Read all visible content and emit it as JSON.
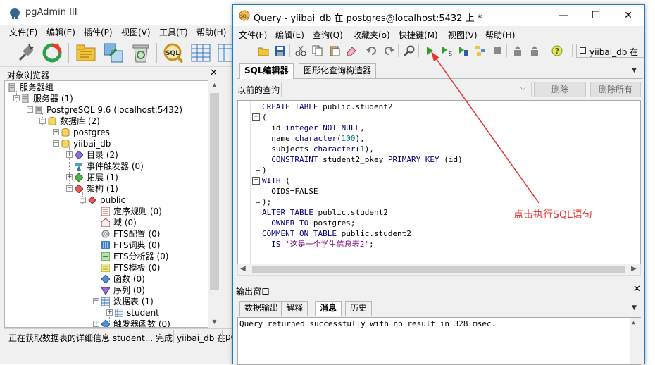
{
  "main": {
    "title": "pgAdmin III",
    "menu": [
      "文件(F)",
      "编辑(E)",
      "插件(P)",
      "视图(V)",
      "工具(T)",
      "帮助(H)"
    ],
    "browser_title": "对象浏览器",
    "close_glyph": "✕",
    "tree": [
      {
        "label": "服务器组",
        "icon": "server-group-icon"
      },
      {
        "label": "服务器 (1)",
        "icon": "servers-icon"
      },
      {
        "label": "PostgreSQL 9.6 (localhost:5432)",
        "icon": "postgres-server-icon"
      },
      {
        "label": "数据库 (2)",
        "icon": "databases-icon"
      },
      {
        "label": "postgres",
        "icon": "database-icon"
      },
      {
        "label": "yiibai_db",
        "icon": "database-icon"
      },
      {
        "label": "目录 (2)",
        "icon": "catalog-icon"
      },
      {
        "label": "事件触发器 (0)",
        "icon": "event-trigger-icon"
      },
      {
        "label": "拓展 (1)",
        "icon": "extension-icon"
      },
      {
        "label": "架构 (1)",
        "icon": "schemas-icon"
      },
      {
        "label": "public",
        "icon": "schema-icon"
      },
      {
        "label": "定序规则 (0)",
        "icon": "collation-icon"
      },
      {
        "label": "域 (0)",
        "icon": "domain-icon"
      },
      {
        "label": "FTS配置 (0)",
        "icon": "fts-config-icon"
      },
      {
        "label": "FTS词典 (0)",
        "icon": "fts-dictionary-icon"
      },
      {
        "label": "FTS分析器 (0)",
        "icon": "fts-parser-icon"
      },
      {
        "label": "FTS模板 (0)",
        "icon": "fts-template-icon"
      },
      {
        "label": "函数 (0)",
        "icon": "function-icon"
      },
      {
        "label": "序列 (0)",
        "icon": "sequence-icon"
      },
      {
        "label": "数据表 (1)",
        "icon": "tables-icon"
      },
      {
        "label": "student",
        "icon": "table-icon"
      },
      {
        "label": "触发器函数 (0)",
        "icon": "trigger-function-icon"
      }
    ],
    "status": [
      "正在获取数据表的详细信息 student... 完成",
      "yiibai_db 在",
      "po"
    ]
  },
  "query": {
    "title": "Query - yiibai_db 在  postgres@localhost:5432 上 *",
    "menu": [
      "文件(F)",
      "编辑(E)",
      "查询(Q)",
      "收藏夹(o)",
      "快捷键(M)",
      "视图(V)",
      "帮助(H)"
    ],
    "db_selector": "yiibai_db 在",
    "tabs": [
      "SQL编辑器",
      "图形化查询构造器"
    ],
    "previous_queries_label": "以前的查询",
    "delete_button": "删除",
    "delete_all_button": "删除所有",
    "code": [
      [
        {
          "c": "kw",
          "t": "CREATE TABLE"
        },
        {
          "t": " public.student2"
        }
      ],
      [
        {
          "t": "("
        }
      ],
      [
        {
          "t": "  id "
        },
        {
          "c": "kw",
          "t": "integer NOT NULL"
        },
        {
          "t": ","
        }
      ],
      [
        {
          "t": "  name "
        },
        {
          "c": "kw",
          "t": "character"
        },
        {
          "t": "("
        },
        {
          "c": "num",
          "t": "100"
        },
        {
          "t": "),"
        }
      ],
      [
        {
          "t": "  subjects "
        },
        {
          "c": "kw",
          "t": "character"
        },
        {
          "t": "("
        },
        {
          "c": "num",
          "t": "1"
        },
        {
          "t": "),"
        }
      ],
      [
        {
          "t": "  "
        },
        {
          "c": "kw",
          "t": "CONSTRAINT"
        },
        {
          "t": " student2_pkey "
        },
        {
          "c": "kw",
          "t": "PRIMARY KEY"
        },
        {
          "t": " (id)"
        }
      ],
      [
        {
          "t": ")"
        }
      ],
      [
        {
          "c": "kw",
          "t": "WITH"
        },
        {
          "t": " ("
        }
      ],
      [
        {
          "t": "  OIDS=FALSE"
        }
      ],
      [
        {
          "t": ");"
        }
      ],
      [
        {
          "c": "kw",
          "t": "ALTER TABLE"
        },
        {
          "t": " public.student2"
        }
      ],
      [
        {
          "t": "  "
        },
        {
          "c": "kw",
          "t": "OWNER TO"
        },
        {
          "t": " postgres;"
        }
      ],
      [
        {
          "c": "kw",
          "t": "COMMENT ON TABLE"
        },
        {
          "t": " public.student2"
        }
      ],
      [
        {
          "t": "  "
        },
        {
          "c": "kw",
          "t": "IS"
        },
        {
          "t": " "
        },
        {
          "c": "str",
          "t": "'这是一个学生信息表2'"
        },
        {
          "t": ";"
        }
      ]
    ],
    "output_title": "输出窗口",
    "output_tabs": [
      "数据输出",
      "解释",
      "消息",
      "历史"
    ],
    "output_active_tab": 2,
    "output_message": "Query returned successfully with no result in 328 msec.",
    "window_buttons": [
      "—",
      "☐",
      "✕"
    ]
  },
  "annotation": "点击执行SQL语句",
  "colors": {
    "accent": "#1c79c8",
    "annotation": "#e53333",
    "keyword": "#00007f"
  }
}
